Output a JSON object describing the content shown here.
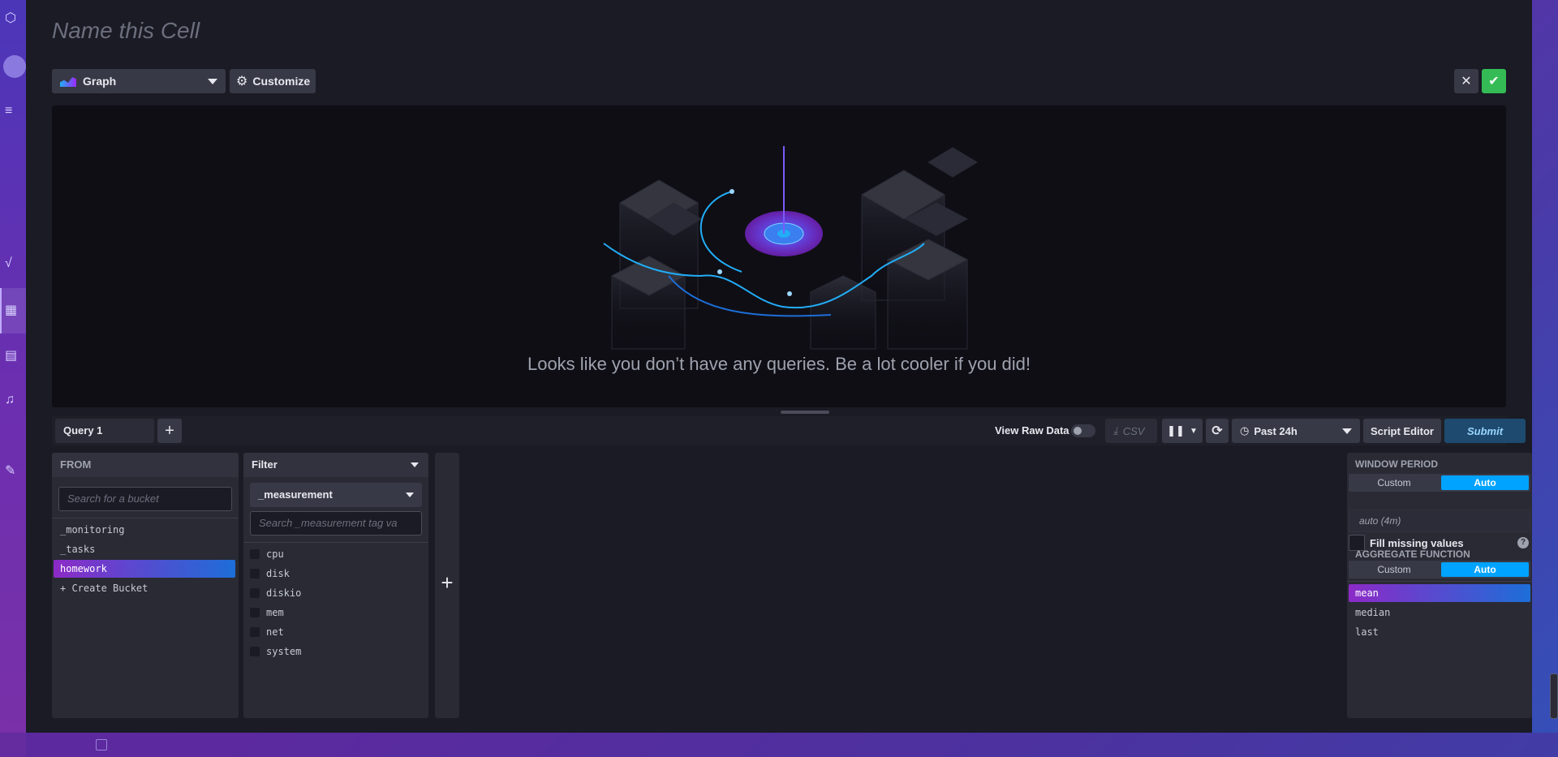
{
  "cell": {
    "title_placeholder": "Name this Cell"
  },
  "toolbar": {
    "view_type_label": "Graph",
    "customize_label": "Customize",
    "close_icon": "✕",
    "confirm_icon": "✔"
  },
  "graph": {
    "empty_message": "Looks like you don’t have any queries. Be a lot cooler if you did!"
  },
  "query_bar": {
    "tab_label": "Query 1",
    "add_label": "+",
    "view_raw_label": "View Raw Data",
    "csv_label": "CSV",
    "time_range_label": "Past 24h",
    "script_editor_label": "Script Editor",
    "submit_label": "Submit"
  },
  "from": {
    "header": "FROM",
    "search_placeholder": "Search for a bucket",
    "buckets": [
      "_monitoring",
      "_tasks",
      "homework"
    ],
    "selected_bucket": "homework",
    "create_label": "+ Create Bucket"
  },
  "filter": {
    "header": "Filter",
    "key": "_measurement",
    "search_placeholder": "Search _measurement tag va",
    "values": [
      "cpu",
      "disk",
      "diskio",
      "mem",
      "net",
      "system"
    ]
  },
  "aggregate": {
    "window_period_title": "WINDOW PERIOD",
    "custom_label": "Custom",
    "auto_label": "Auto",
    "period_value": "auto (4m)",
    "fill_missing_label": "Fill missing values",
    "help_label": "?",
    "aggregate_title": "AGGREGATE FUNCTION",
    "functions": [
      "mean",
      "median",
      "last"
    ],
    "selected_function": "mean"
  },
  "colors": {
    "accent_blue": "#00a3ff",
    "confirm_green": "#34bb55",
    "selection_gradient_start": "#8c2ac7",
    "selection_gradient_end": "#1d6ed8"
  }
}
